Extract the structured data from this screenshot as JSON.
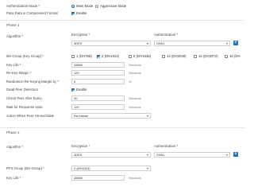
{
  "auth_mode": {
    "label": "Authentication Mode *",
    "options": [
      "Main Mode",
      "Aggressive Mode"
    ],
    "selected": "Main Mode"
  },
  "compressed": {
    "label": "Pass Data in Compressed Format",
    "checkbox_label": "Enable",
    "checked": true
  },
  "phase1": {
    "title": "Phase 1",
    "algorithm_label": "Algorithm *",
    "encryption_label": "Encryption *",
    "encryption_value": "3DES",
    "authentication_label": "Authentication *",
    "authentication_value": "SHA1",
    "dh_label": "DH Group (Key Group) *",
    "dh_options": [
      {
        "label": "1 (DH768)",
        "checked": false
      },
      {
        "label": "2 (DH1024)",
        "checked": true
      },
      {
        "label": "5 (DH1536)",
        "checked": false
      },
      {
        "label": "14 (DH2048)",
        "checked": false
      },
      {
        "label": "15 (DH3072)",
        "checked": false
      },
      {
        "label": "16 (DH",
        "checked": false
      }
    ],
    "key_life_label": "Key Life *",
    "key_life_value": "28800",
    "key_life_units": "Seconds",
    "rekey_margin_label": "Re-Key Margin *",
    "rekey_margin_value": "120",
    "rekey_margin_units": "Seconds",
    "randomize_label": "Randomize Re-Keying Margin by *",
    "randomize_value": "0",
    "randomize_units": "%",
    "dpd_label": "Dead Peer Detection",
    "dpd_checkbox_label": "Enable",
    "dpd_checked": true,
    "check_peer_label": "Check Peer After Every",
    "check_peer_value": "30",
    "check_peer_units": "Seconds",
    "wait_label": "Wait for Response Upto",
    "wait_value": "120",
    "wait_units": "Seconds",
    "action_label": "Action When Peer Unreachable",
    "action_value": "Re-initiate"
  },
  "phase2": {
    "title": "Phase 2",
    "algorithm_label": "Algorithm *",
    "encryption_label": "Encryption *",
    "encryption_value": "3DES",
    "authentication_label": "Authentication *",
    "authentication_value": "SHA1",
    "pfs_label": "PFS Group (DH Group) *",
    "pfs_value": "2 (DH1024)",
    "key_life_label": "Key Life *",
    "key_life_value": "28800",
    "key_life_units": "Seconds"
  },
  "colors": {
    "accent": "#1a73c8",
    "border": "#cfcfcf"
  }
}
